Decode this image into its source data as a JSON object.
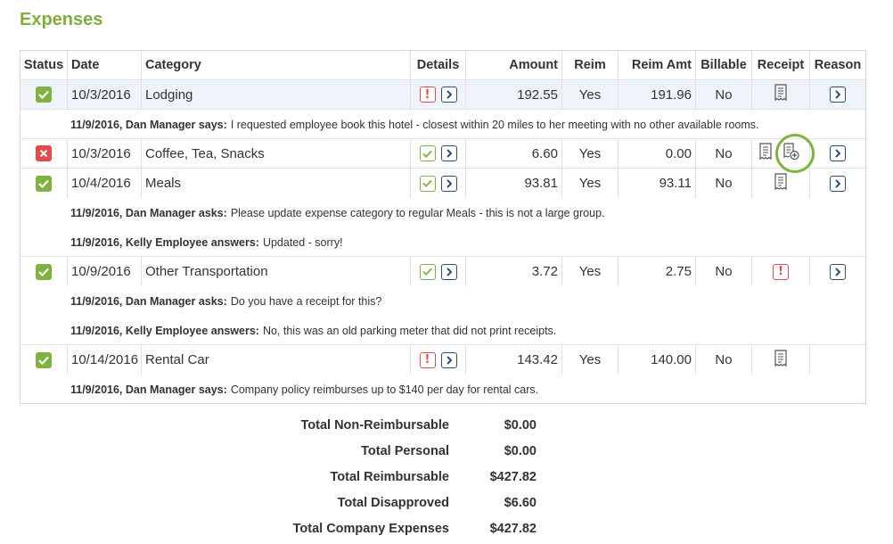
{
  "page_title": "Expenses",
  "columns": {
    "status": "Status",
    "date": "Date",
    "category": "Category",
    "details": "Details",
    "amount": "Amount",
    "reim": "Reim",
    "reim_amt": "Reim Amt",
    "billable": "Billable",
    "receipt": "Receipt",
    "reason": "Reason"
  },
  "expenses": [
    {
      "status": "approved",
      "date": "10/3/2016",
      "category": "Lodging",
      "details_status": "warning",
      "amount": "192.55",
      "reim": "Yes",
      "reim_amt": "191.96",
      "billable": "No",
      "receipt": "receipt-icon",
      "highlighted": true,
      "comments": [
        {
          "author": "11/9/2016, Dan Manager says:",
          "text": "I requested employee book this hotel - closest within 20 miles to her meeting with no other available rooms."
        }
      ]
    },
    {
      "status": "rejected",
      "date": "10/3/2016",
      "category": "Coffee, Tea, Snacks",
      "details_status": "ok",
      "amount": "6.60",
      "reim": "Yes",
      "reim_amt": "0.00",
      "billable": "No",
      "receipt": "receipt-icon",
      "comments": []
    },
    {
      "status": "approved",
      "date": "10/4/2016",
      "category": "Meals",
      "details_status": "ok",
      "amount": "93.81",
      "reim": "Yes",
      "reim_amt": "93.11",
      "billable": "No",
      "receipt": "receipt-icon",
      "comments": [
        {
          "author": "11/9/2016, Dan Manager asks:",
          "text": "Please update expense category to regular Meals - this is not a large group."
        },
        {
          "author": "11/9/2016, Kelly Employee answers:",
          "text": "Updated - sorry!"
        }
      ]
    },
    {
      "status": "approved",
      "date": "10/9/2016",
      "category": "Other Transportation",
      "details_status": "ok",
      "amount": "3.72",
      "reim": "Yes",
      "reim_amt": "2.75",
      "billable": "No",
      "receipt": "missing-receipt-warning-icon",
      "comments": [
        {
          "author": "11/9/2016, Dan Manager asks:",
          "text": "Do you have a receipt for this?"
        },
        {
          "author": "11/9/2016, Kelly Employee answers:",
          "text": "No, this was an old parking meter that did not print receipts."
        }
      ]
    },
    {
      "status": "approved",
      "date": "10/14/2016",
      "category": "Rental Car",
      "details_status": "warning",
      "amount": "143.42",
      "reim": "Yes",
      "reim_amt": "140.00",
      "billable": "No",
      "receipt": "receipt-icon",
      "comments": [
        {
          "author": "11/9/2016, Dan Manager says:",
          "text": "Company policy reimburses up to $140 per day for rental cars."
        }
      ]
    }
  ],
  "totals": [
    {
      "label": "Total Non-Reimbursable",
      "value": "$0.00"
    },
    {
      "label": "Total Personal",
      "value": "$0.00"
    },
    {
      "label": "Total Reimbursable",
      "value": "$427.82"
    },
    {
      "label": "Total Disapproved",
      "value": "$6.60"
    },
    {
      "label": "Total Company Expenses",
      "value": "$427.82"
    }
  ],
  "colors": {
    "accent": "#7fae3c",
    "approved": "#7fb241",
    "rejected": "#e54b4b",
    "nav": "#2d4f73"
  }
}
